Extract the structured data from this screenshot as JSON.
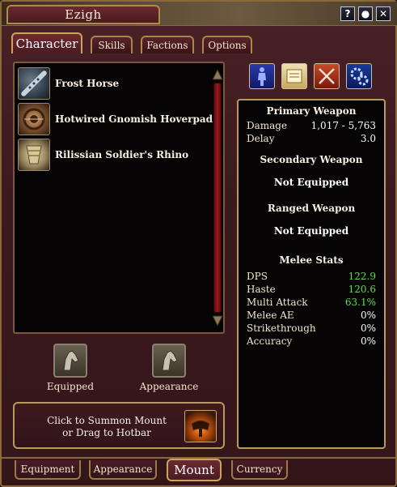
{
  "window": {
    "title": "Ezigh",
    "controls": [
      {
        "name": "help-button",
        "glyph": "?"
      },
      {
        "name": "options-button",
        "glyph": "●"
      },
      {
        "name": "close-button",
        "glyph": "✕"
      }
    ]
  },
  "top_tabs": [
    {
      "label": "Character",
      "active": true
    },
    {
      "label": "Skills",
      "active": false
    },
    {
      "label": "Factions",
      "active": false
    },
    {
      "label": "Options",
      "active": false
    }
  ],
  "mount_list": [
    {
      "label": "Frost Horse",
      "icon": "flute-icon"
    },
    {
      "label": "Hotwired Gnomish Hoverpad",
      "icon": "gear-device-icon"
    },
    {
      "label": "Rilissian Soldier's Rhino",
      "icon": "horn-icon"
    }
  ],
  "slots": {
    "equipped_label": "Equipped",
    "appearance_label": "Appearance",
    "slot_icon": "horse-head-icon"
  },
  "summon": {
    "line1": "Click to Summon Mount",
    "line2": "or Drag to Hotbar",
    "icon": "saddle-icon"
  },
  "view_icons": [
    "character-model-icon",
    "scroll-icon",
    "crossed-swords-icon",
    "gears-icon"
  ],
  "stats": {
    "primary_title": "Primary Weapon",
    "damage_label": "Damage",
    "damage_value": "1,017 - 5,763",
    "delay_label": "Delay",
    "delay_value": "3.0",
    "secondary_title": "Secondary Weapon",
    "secondary_value": "Not Equipped",
    "ranged_title": "Ranged Weapon",
    "ranged_value": "Not Equipped",
    "melee_title": "Melee Stats",
    "melee": [
      {
        "label": "DPS",
        "value": "122.9",
        "highlight": true
      },
      {
        "label": "Haste",
        "value": "120.6",
        "highlight": true
      },
      {
        "label": "Multi Attack",
        "value": "63.1%",
        "highlight": true
      },
      {
        "label": "Melee AE",
        "value": "0%",
        "highlight": false
      },
      {
        "label": "Strikethrough",
        "value": "0%",
        "highlight": false
      },
      {
        "label": "Accuracy",
        "value": "0%",
        "highlight": false
      }
    ]
  },
  "bottom_tabs": [
    {
      "label": "Equipment",
      "active": false
    },
    {
      "label": "Appearance",
      "active": false
    },
    {
      "label": "Mount",
      "active": true
    },
    {
      "label": "Currency",
      "active": false
    }
  ],
  "colors": {
    "highlight_green": "#5fdc4a",
    "frame_gold": "#b89a5a",
    "window_maroon": "#3b1a1e"
  }
}
